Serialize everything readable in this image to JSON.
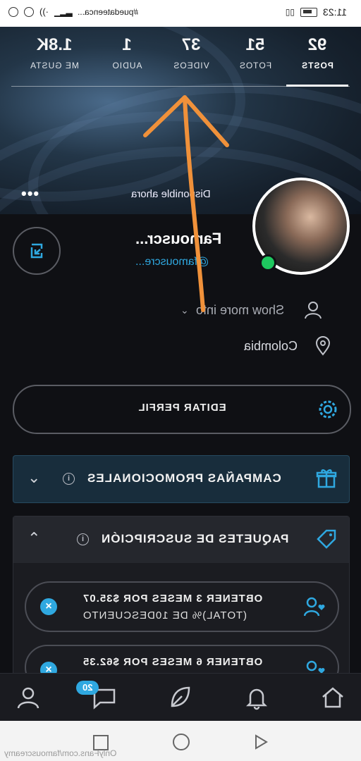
{
  "status_bar": {
    "time": "11:23",
    "hashtag": "#puedateenca..."
  },
  "tabs": [
    {
      "count": "92",
      "label": "POSTS"
    },
    {
      "count": "51",
      "label": "FOTOS"
    },
    {
      "count": "37",
      "label": "VIDEOS"
    },
    {
      "count": "1",
      "label": "AUDIO"
    },
    {
      "count": "1.8K",
      "label": "ME GUSTA"
    }
  ],
  "cover": {
    "availability": "Disponible ahora",
    "more_dots": "•••"
  },
  "profile": {
    "name": "Famouscr...",
    "handle": "@famouscre...",
    "show_more": "Show more info",
    "location": "Colombia"
  },
  "edit_profile_label": "EDITAR PERFIL",
  "campaigns": {
    "title": "CAMPAÑAS PROMOCIONALES"
  },
  "packages": {
    "title": "PAQUETES DE SUSCRIPCIÓN",
    "offers": [
      {
        "line1": "OBTENER 3 MESES POR $35.07",
        "line2": "(TOTAL)% DE 10DESCUENTO"
      },
      {
        "line1": "OBTENER 6 MESES POR $62.35",
        "line2": ""
      }
    ]
  },
  "bottom_nav": {
    "messages_badge": "20"
  },
  "watermark": "OnlyFans.com/famouscreamy",
  "colors": {
    "accent": "#2fa8e0",
    "online": "#1ec85f",
    "annotation_arrow": "#f0913a"
  }
}
